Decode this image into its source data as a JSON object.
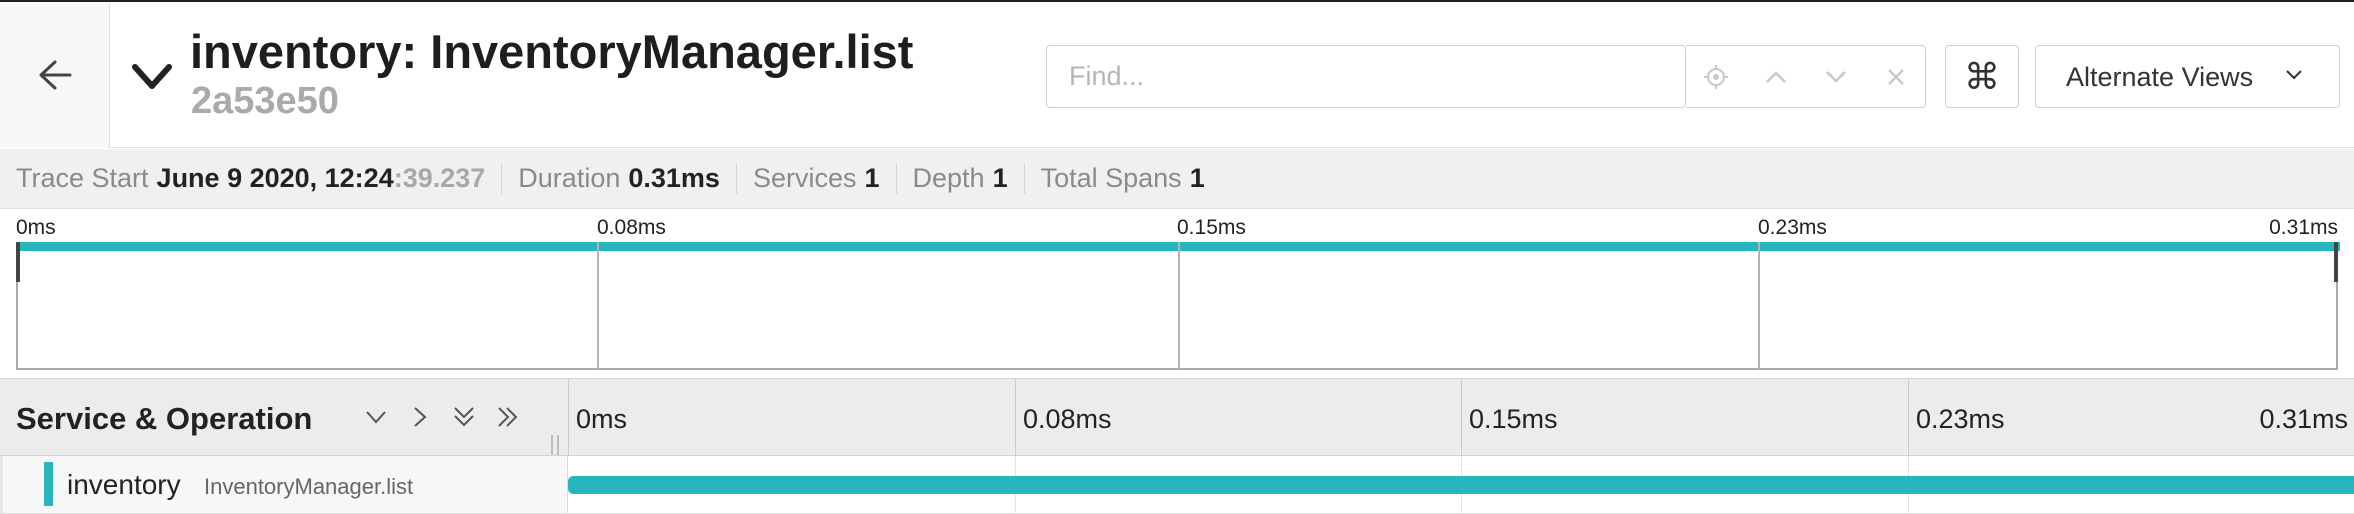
{
  "header": {
    "back_icon": "arrow-left-icon",
    "collapse_icon": "chevron-down-icon",
    "title": "inventory: InventoryManager.list",
    "trace_id": "2a53e50",
    "search": {
      "placeholder": "Find...",
      "value": ""
    },
    "search_actions": [
      "locate-icon",
      "chevron-up-icon",
      "chevron-down-icon",
      "close-icon"
    ],
    "keyboard_shortcuts_glyph": "⌘",
    "alternate_views_label": "Alternate Views"
  },
  "summary": {
    "trace_start_label": "Trace Start",
    "trace_start_value": "June 9 2020, 12:24",
    "trace_start_seconds": ":39.237",
    "duration_label": "Duration",
    "duration_value": "0.31ms",
    "services_label": "Services",
    "services_value": "1",
    "depth_label": "Depth",
    "depth_value": "1",
    "total_spans_label": "Total Spans",
    "total_spans_value": "1"
  },
  "minimap": {
    "ticks": [
      "0ms",
      "0.08ms",
      "0.15ms",
      "0.23ms",
      "0.31ms"
    ]
  },
  "span_table": {
    "column_title": "Service & Operation",
    "tree_controls": [
      "collapse-one-icon",
      "expand-one-icon",
      "collapse-all-icon",
      "expand-all-icon"
    ],
    "ticks": [
      "0ms",
      "0.08ms",
      "0.15ms",
      "0.23ms",
      "0.31ms"
    ],
    "rows": [
      {
        "service": "inventory",
        "operation": "InventoryManager.list",
        "color": "#27b6be",
        "start_fraction": 0,
        "duration_fraction": 1
      }
    ]
  },
  "colors": {
    "span": "#27b6be"
  }
}
